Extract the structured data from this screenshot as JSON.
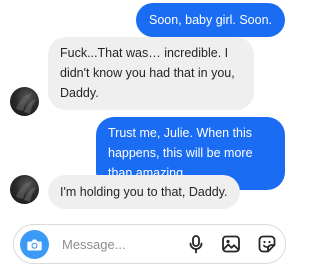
{
  "thread": {
    "messages": [
      {
        "direction": "outgoing",
        "text": "Soon, baby girl. Soon."
      },
      {
        "direction": "incoming",
        "text": "Fuck...That was… incredible. I didn't know you had that in you, Daddy."
      },
      {
        "direction": "outgoing",
        "text": "Trust me, Julie. When this happens, this will be more than amazing"
      },
      {
        "direction": "incoming",
        "text": "I'm holding you to that, Daddy."
      }
    ]
  },
  "composer": {
    "placeholder": "Message...",
    "icons": [
      "camera-icon",
      "microphone-icon",
      "image-icon",
      "sticker-icon"
    ]
  },
  "colors": {
    "outgoing_bubble": "#1a6cf3",
    "incoming_bubble": "#efefef",
    "camera_button": "#3b9af6"
  }
}
